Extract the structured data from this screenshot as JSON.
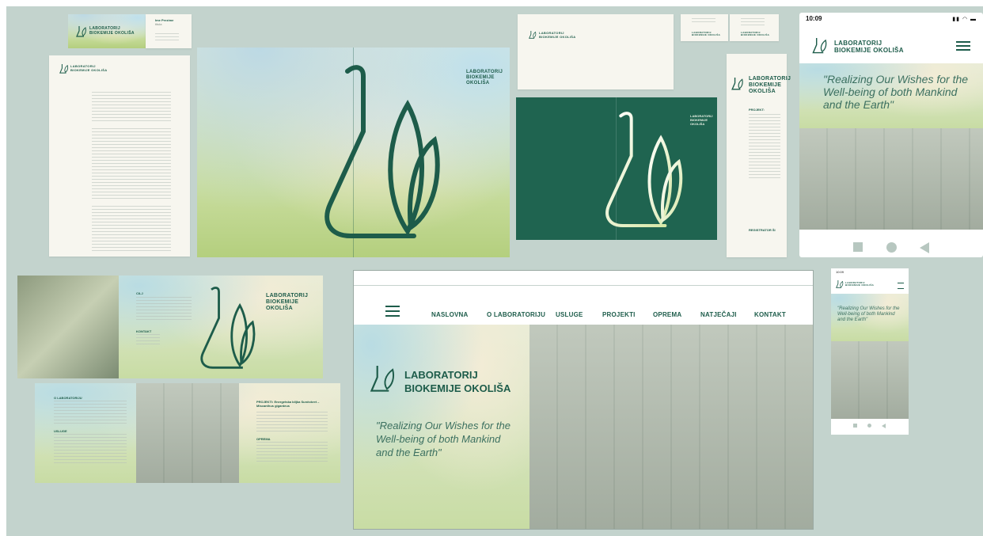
{
  "brand": {
    "name_line1": "LABORATORIJ",
    "name_line2": "BIOKEMIJE OKOLIŠA",
    "name_line1_alt": "LABORATORIJ",
    "name_line2_alt": "BIOKEMIJE",
    "name_line3_alt": "OKOLIŠA",
    "tagline": "\"Realizing Our Wishes for the Well-being of both Mankind and the Earth\"",
    "color_primary": "#1d5c4a",
    "color_board": "#c3d3cd"
  },
  "business_card": {
    "person": "Ime Prezime",
    "role": "titula"
  },
  "folder": {
    "projekt_label": "PROJEKT:",
    "registration_label": "REGISTRATOR ŠI"
  },
  "mobile": {
    "time": "10:09",
    "status_icons": "signal-wifi-battery",
    "menu_icon": "hamburger-menu-icon",
    "tagline": "\"Realizing Our Wishes for the Well-being of both Mankind and the Earth\""
  },
  "brochure": {
    "section_ciljevi": "CILJ",
    "section_kontakt": "KONTAKT",
    "section_o_lab": "O LABORATORIJU",
    "section_usluge": "USLUGE",
    "section_projekti": "PROJEKTI: Energetska biljka Sunčokret – Miscanthus giganteus",
    "section_oprema": "OPREMA"
  },
  "website": {
    "nav": [
      "NASLOVNA",
      "O LABORATORIJU",
      "USLUGE",
      "PROJEKTI",
      "OPREMA",
      "NATJEČAJI",
      "KONTAKT"
    ],
    "tagline": "\"Realizing Our Wishes for the Well-being of both Mankind and the Earth\""
  },
  "small_mobile": {
    "time": "10:09",
    "tagline": "\"Realizing Our Wishes for the Well-being of both Mankind and the Earth\""
  }
}
